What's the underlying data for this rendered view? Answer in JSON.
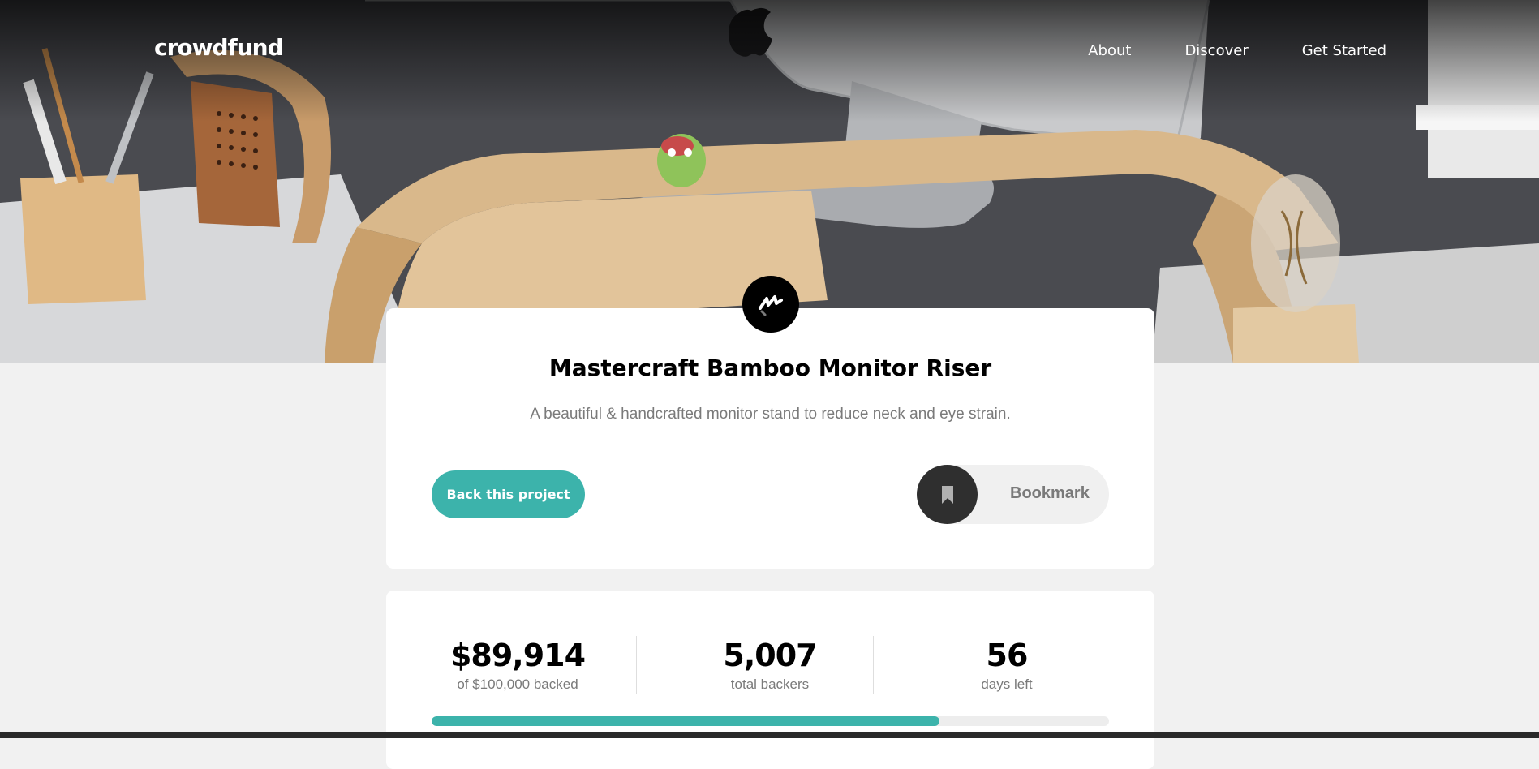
{
  "header": {
    "brand": "crowdfund",
    "nav": [
      {
        "label": "About"
      },
      {
        "label": "Discover"
      },
      {
        "label": "Get Started"
      }
    ]
  },
  "project": {
    "title": "Mastercraft Bamboo Monitor Riser",
    "description": "A beautiful & handcrafted monitor stand to reduce neck and eye strain.",
    "back_button_label": "Back this project",
    "bookmark_label": "Bookmark"
  },
  "stats": [
    {
      "value": "$89,914",
      "label": "of $100,000 backed"
    },
    {
      "value": "5,007",
      "label": "total backers"
    },
    {
      "value": "56",
      "label": "days left"
    }
  ],
  "progress": {
    "fraction": 0.75
  },
  "colors": {
    "accent": "#3cb3ab",
    "dark": "#2f2f2f",
    "background": "#f1f1f1",
    "muted_text": "#7a7a7a"
  },
  "icons": {
    "logo": "mastercraft-logo-icon",
    "bookmark": "bookmark-icon"
  }
}
